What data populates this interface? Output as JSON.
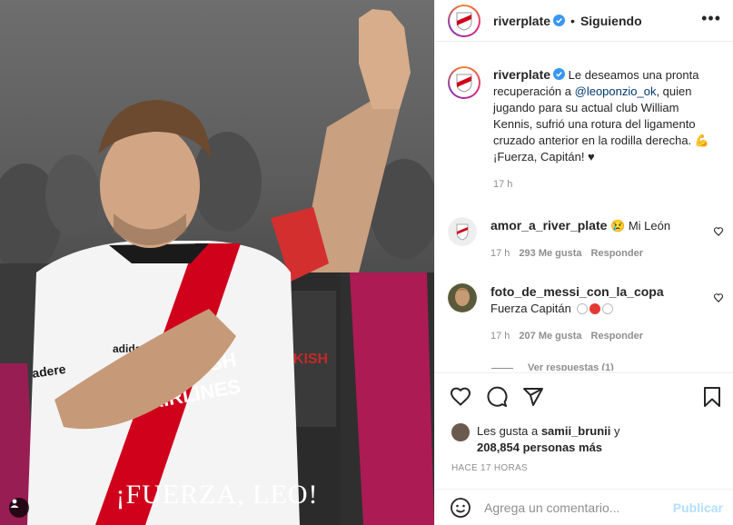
{
  "photo": {
    "overlay_text": "¡FUERZA, LEO!",
    "jersey_text": "TURKISH AIRLINES",
    "sponsor_text": "adidas",
    "sleeve_text": "adere"
  },
  "header": {
    "username": "riverplate",
    "separator": "•",
    "follow_status": "Siguiendo"
  },
  "caption": {
    "username": "riverplate",
    "text_before": " Le deseamos una pronta recuperación a ",
    "mention": "@leoponzio_ok",
    "text_after": ", quien jugando para su actual club William Kennis, sufrió una rotura del ligamento cruzado anterior en la rodilla derecha. 💪 ¡Fuerza, Capitán! ♥",
    "time": "17 h"
  },
  "comments": [
    {
      "username": "amor_a_river_plate",
      "text": " 😢 Mi León",
      "time": "17 h",
      "likes": "293 Me gusta",
      "reply": "Responder"
    },
    {
      "username": "foto_de_messi_con_la_copa",
      "text": " Fuerza Capitán ",
      "time": "17 h",
      "likes": "207 Me gusta",
      "reply": "Responder"
    }
  ],
  "view_replies": "Ver respuestas (1)",
  "likes": {
    "prefix": "Les gusta a ",
    "user": "samii_brunii",
    "middle": " y",
    "count": "208,854 personas más"
  },
  "timestamp": "HACE 17 HORAS",
  "add_comment": {
    "placeholder": "Agrega un comentario...",
    "publish": "Publicar"
  },
  "colors": {
    "river_red": "#d0021b",
    "verified_blue": "#3897f0",
    "link_blue": "#00376b",
    "publish_disabled": "#b2dffc"
  }
}
